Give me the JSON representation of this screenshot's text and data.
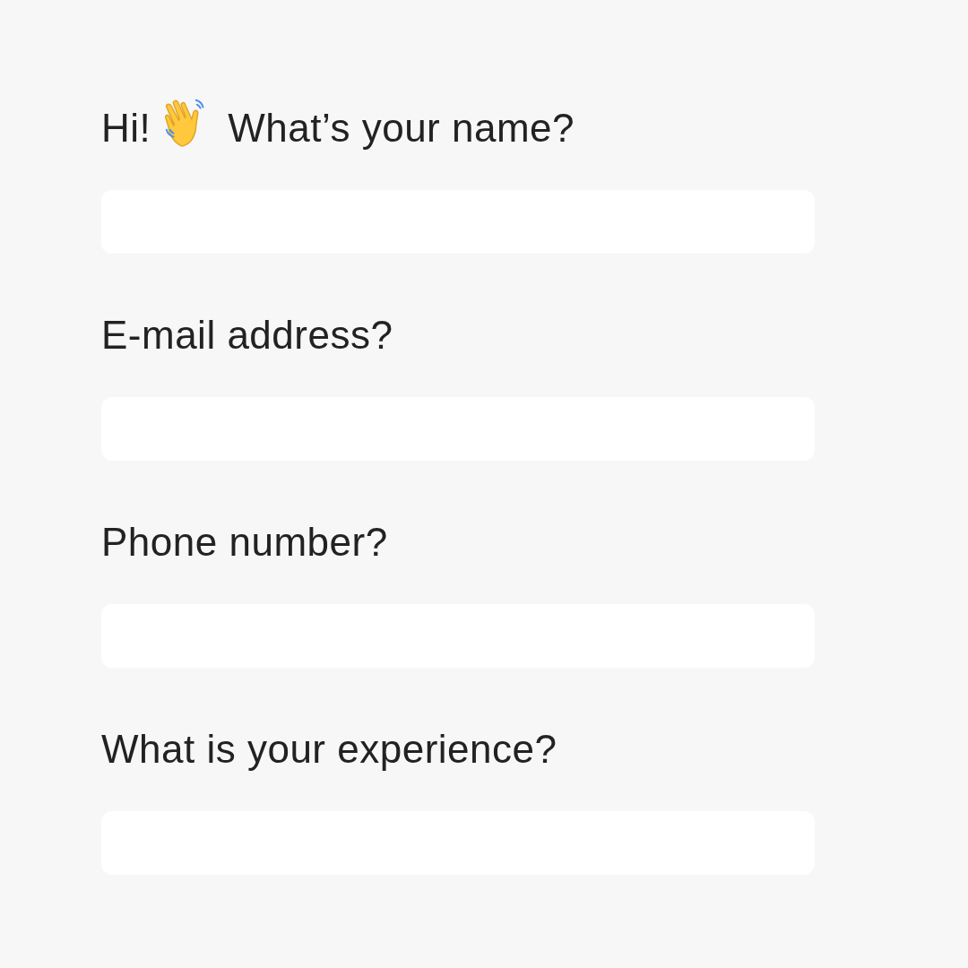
{
  "questions": [
    {
      "greeting": "Hi!",
      "label": "What’s your name?"
    },
    {
      "label": "E-mail address?"
    },
    {
      "label": "Phone number?"
    },
    {
      "label": "What is your experience?"
    }
  ]
}
